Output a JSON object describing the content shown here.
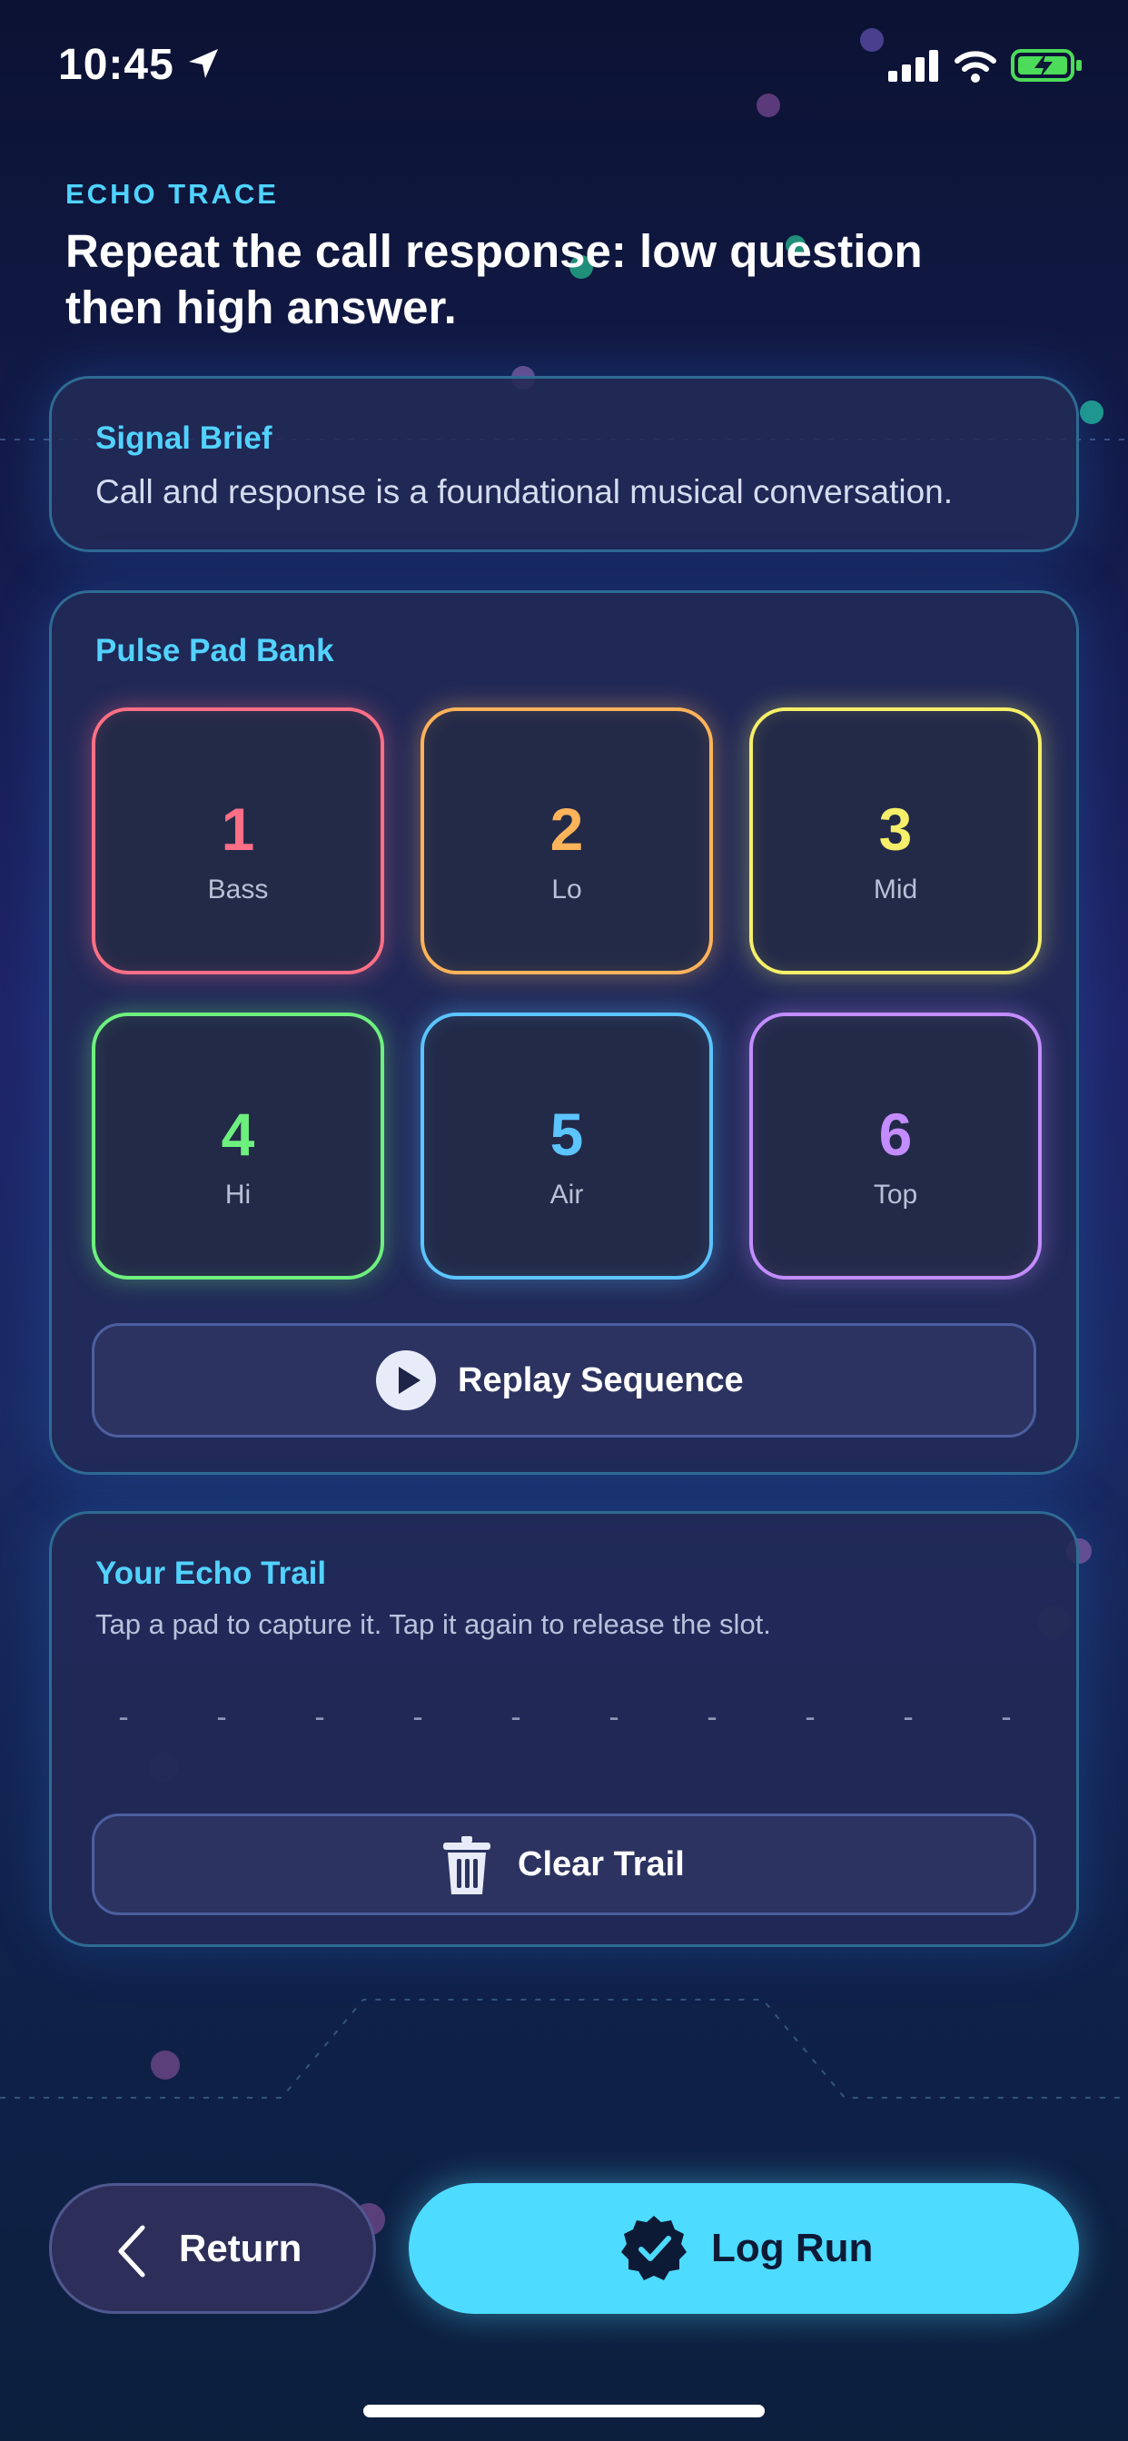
{
  "status_bar": {
    "time": "10:45",
    "icons": [
      "location-arrow-icon",
      "cellular-signal-icon",
      "wifi-icon",
      "battery-charging-icon"
    ]
  },
  "header": {
    "eyebrow": "ECHO TRACE",
    "headline": "Repeat the call response: low question then high answer."
  },
  "brief": {
    "label": "Signal Brief",
    "text": "Call and response is a foundational musical conversation."
  },
  "pad_bank": {
    "label": "Pulse Pad Bank",
    "pads": [
      {
        "number": "1",
        "name": "Bass",
        "color": "#ff6f86"
      },
      {
        "number": "2",
        "name": "Lo",
        "color": "#ffb35a"
      },
      {
        "number": "3",
        "name": "Mid",
        "color": "#f5ef6a"
      },
      {
        "number": "4",
        "name": "Hi",
        "color": "#6ef07e"
      },
      {
        "number": "5",
        "name": "Air",
        "color": "#5cc4ff"
      },
      {
        "number": "6",
        "name": "Top",
        "color": "#c38cff"
      }
    ],
    "replay_label": "Replay Sequence",
    "replay_icon": "play-icon"
  },
  "trail": {
    "label": "Your Echo Trail",
    "help": "Tap a pad to capture it. Tap it again to release the slot.",
    "slots": [
      "-",
      "-",
      "-",
      "-",
      "-",
      "-",
      "-",
      "-",
      "-",
      "-"
    ],
    "clear_label": "Clear Trail",
    "clear_icon": "trash-icon"
  },
  "actions": {
    "return_label": "Return",
    "return_icon": "chevron-left-icon",
    "log_label": "Log Run",
    "log_icon": "verified-badge-icon"
  },
  "colors": {
    "accent": "#4ddbff",
    "label_blue": "#52d2ff",
    "card_bg": "#222a56",
    "card_border": "#2f6b93"
  }
}
